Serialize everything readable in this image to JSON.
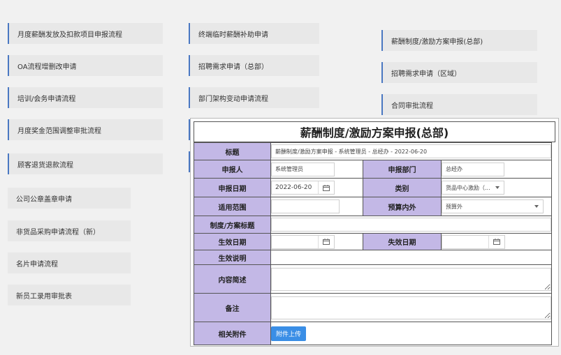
{
  "menu": {
    "col1": [
      "月度薪酬发放及扣款项目申报流程",
      "OA流程增删改申请",
      "培训/会务申请流程",
      "月度奖金范围调整审批流程",
      "顾客退货退款流程",
      "公司公章盖章申请",
      "非货品采购申请流程（新）",
      "名片申请流程",
      "新员工录用审批表"
    ],
    "col2": [
      "终端临时薪酬补助申请",
      "招聘需求申请（总部）",
      "部门架构变动申请流程"
    ],
    "col3": [
      "薪酬制度/激励方案申报(总部)",
      "招聘需求申请（区域）",
      "合同审批流程"
    ]
  },
  "form": {
    "title": "薪酬制度/激励方案申报(总部)",
    "labels": {
      "subject": "标题",
      "applicant": "申报人",
      "department": "申报部门",
      "apply_date": "申报日期",
      "category": "类别",
      "scope": "适用范围",
      "budget": "预算内外",
      "plan_title": "制度/方案标题",
      "effective_date": "生效日期",
      "expiry_date": "失效日期",
      "effective_note": "生效说明",
      "summary": "内容简述",
      "remarks": "备注",
      "attachments": "相关附件"
    },
    "values": {
      "subject": "薪酬制度/激励方案申报 - 系统管理员 - 总经办 - 2022-06-20",
      "applicant": "系统管理员",
      "department": "总经办",
      "apply_date": "2022-06-20",
      "category": "货品中心激励（...",
      "scope": "",
      "budget": "预算外",
      "plan_title": "",
      "effective_date": "",
      "expiry_date": "",
      "effective_note": "",
      "summary": "",
      "remarks": ""
    },
    "upload_label": "附件上传"
  },
  "colors": {
    "label_bg": "#c3b8e6",
    "accent_border": "#4a78c2",
    "upload_button": "#3a8ee6",
    "page_bg": "#f1f1f1"
  }
}
